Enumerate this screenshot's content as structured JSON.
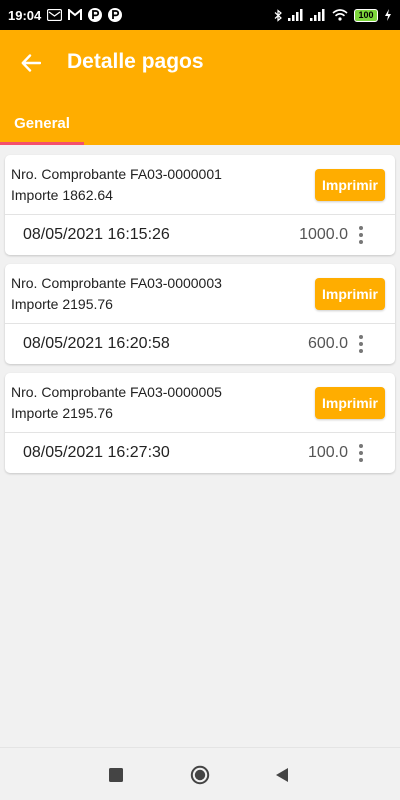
{
  "status_bar": {
    "time": "19:04",
    "battery": "100",
    "left_icons": [
      "mail-icon",
      "gmail-icon",
      "parking-icon",
      "parking-icon"
    ],
    "right_icons": [
      "bluetooth-icon",
      "signal-icon",
      "signal-icon",
      "wifi-icon",
      "battery-icon",
      "charging-icon"
    ]
  },
  "app_bar": {
    "title": "Detalle pagos",
    "back_icon": "arrow-left-icon",
    "tabs": [
      {
        "label": "General",
        "active": true
      }
    ],
    "colors": {
      "primary": "#ffad00",
      "tab_indicator": "#f4506a"
    }
  },
  "payments": [
    {
      "voucher": "Nro. Comprobante FA03-0000001",
      "amount_total": "Importe 1862.64",
      "print_label": "Imprimir",
      "datetime": "08/05/2021 16:15:26",
      "paid": "1000.0"
    },
    {
      "voucher": "Nro. Comprobante FA03-0000003",
      "amount_total": "Importe 2195.76",
      "print_label": "Imprimir",
      "datetime": "08/05/2021 16:20:58",
      "paid": "600.0"
    },
    {
      "voucher": "Nro. Comprobante FA03-0000005",
      "amount_total": "Importe 2195.76",
      "print_label": "Imprimir",
      "datetime": "08/05/2021 16:27:30",
      "paid": "100.0"
    }
  ],
  "nav_bar": {
    "buttons": [
      "recents-square-icon",
      "home-circle-icon",
      "back-triangle-icon"
    ]
  }
}
